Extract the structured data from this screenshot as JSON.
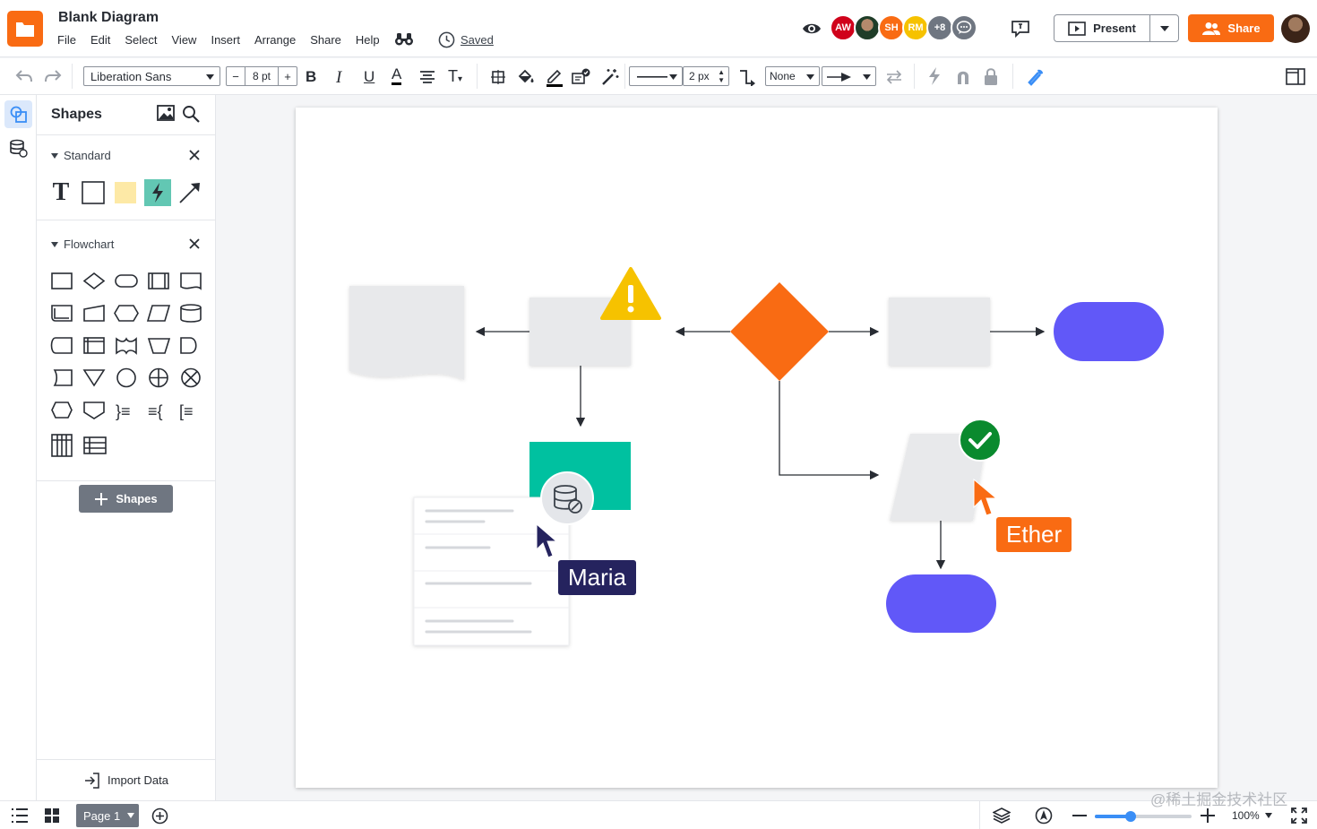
{
  "header": {
    "title": "Blank Diagram",
    "menu": [
      "File",
      "Edit",
      "Select",
      "View",
      "Insert",
      "Arrange",
      "Share",
      "Help"
    ],
    "saved_label": "Saved",
    "collaborators": [
      {
        "initials": "AW",
        "color": "#d0021b"
      },
      {
        "initials": "",
        "color": "#2f7d43"
      },
      {
        "initials": "SH",
        "color": "#f96b13"
      },
      {
        "initials": "RM",
        "color": "#f6c200"
      },
      {
        "initials": "+8",
        "color": "#6f7681"
      }
    ],
    "present_label": "Present",
    "share_label": "Share"
  },
  "toolbar": {
    "font_family": "Liberation Sans",
    "font_size": "8 pt",
    "bold": "B",
    "italic": "I",
    "underline": "U",
    "font_color_glyph": "A",
    "text_options_glyph": "T",
    "line_width": "2 px",
    "arrow_start": "None",
    "size_minus": "−",
    "size_plus": "+"
  },
  "shapes_panel": {
    "title": "Shapes",
    "libraries": [
      {
        "name": "Standard"
      },
      {
        "name": "Flowchart"
      }
    ],
    "standard_text_glyph": "T",
    "flowchart_glyphs": [
      "}≡",
      "≡{",
      "[≡"
    ],
    "add_shapes_label": "Shapes",
    "import_data_label": "Import Data"
  },
  "canvas": {
    "cursors": [
      {
        "name": "Maria",
        "color": "#25235e"
      },
      {
        "name": "Ether",
        "color": "#f96b13"
      }
    ],
    "colors": {
      "diamond": "#f96b13",
      "terminal": "#6158f8",
      "teal": "#00c1a0",
      "gray_shape": "#e8e9eb",
      "warning": "#f6c200",
      "success": "#0a8a2e"
    }
  },
  "bottom": {
    "page_label": "Page 1",
    "zoom_value": "100%",
    "zoom_level": 0.37
  },
  "watermark": "@稀土掘金技术社区"
}
